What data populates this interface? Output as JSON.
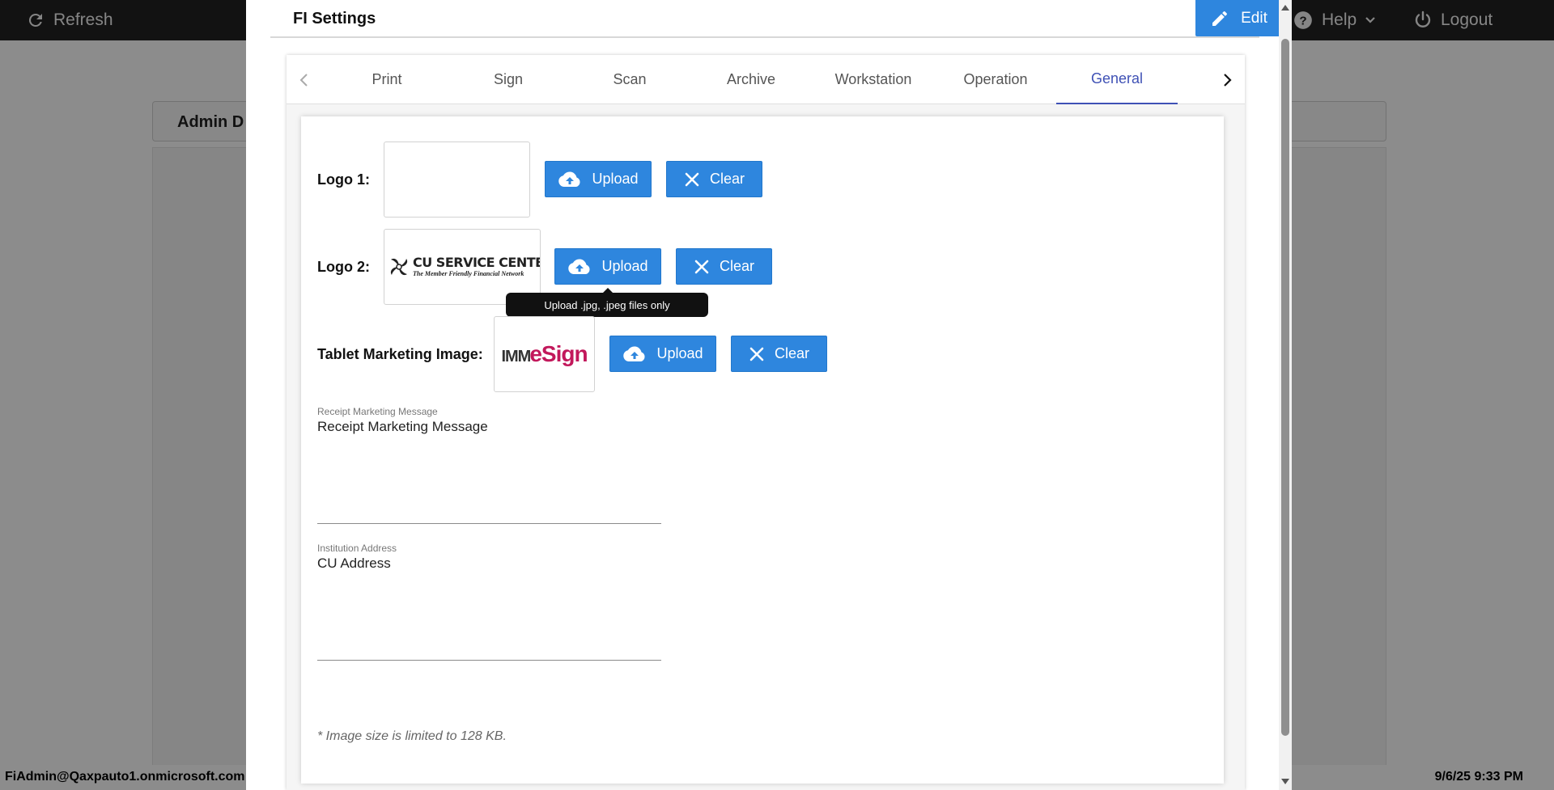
{
  "header": {
    "refresh_label": "Refresh",
    "help_label": "Help",
    "logout_label": "Logout"
  },
  "background": {
    "admin_title": "Admin D"
  },
  "footer": {
    "user": "FiAdmin@Qaxpauto1.onmicrosoft.com",
    "datetime": "9/6/25 9:33 PM"
  },
  "dialog": {
    "title": "FI Settings",
    "edit_label": "Edit",
    "tabs": [
      "Print",
      "Sign",
      "Scan",
      "Archive",
      "Workstation",
      "Operation",
      "General"
    ],
    "active_tab": "General"
  },
  "general": {
    "logo1_label": "Logo 1:",
    "logo2_label": "Logo 2:",
    "tablet_label": "Tablet Marketing Image:",
    "upload_label": "Upload",
    "clear_label": "Clear",
    "tooltip": "Upload .jpg, .jpeg files only",
    "logo2_image": {
      "brand": "CU SERVICE CENTERS",
      "registered": "®",
      "tagline": "The Member Friendly Financial Network"
    },
    "tablet_image": {
      "prefix": "IMM",
      "brand": "eSign"
    },
    "receipt_field": {
      "label": "Receipt Marketing Message",
      "value": "Receipt Marketing Message"
    },
    "address_field": {
      "label": "Institution Address",
      "value": "CU Address"
    },
    "note": "* Image size is limited to 128 KB."
  },
  "colors": {
    "primary": "#2e86de",
    "active_tab": "#3f51b5",
    "header_bg": "#222222"
  }
}
